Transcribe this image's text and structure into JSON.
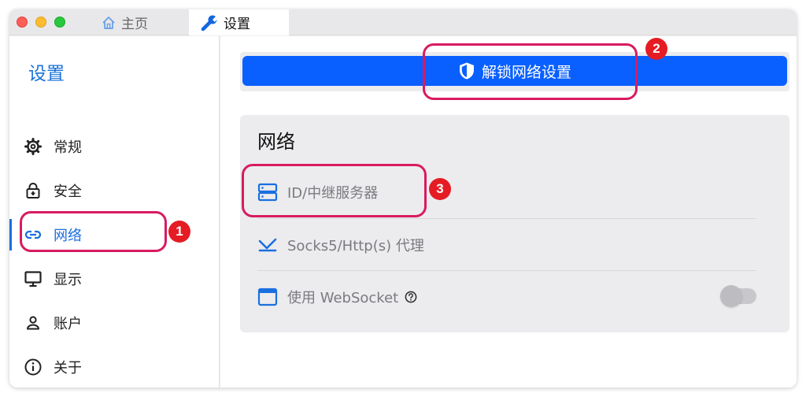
{
  "tabs": [
    {
      "label": "主页",
      "icon": "home-icon"
    },
    {
      "label": "设置",
      "icon": "wrench-icon"
    }
  ],
  "sidebar": {
    "title": "设置",
    "items": [
      {
        "label": "常规",
        "icon": "gear-icon"
      },
      {
        "label": "安全",
        "icon": "lock-icon"
      },
      {
        "label": "网络",
        "icon": "link-icon",
        "active": true
      },
      {
        "label": "显示",
        "icon": "monitor-icon"
      },
      {
        "label": "账户",
        "icon": "user-icon"
      },
      {
        "label": "关于",
        "icon": "info-icon"
      }
    ]
  },
  "unlock_button": {
    "label": "解锁网络设置",
    "icon": "shield-icon"
  },
  "network": {
    "title": "网络",
    "rows": [
      {
        "label": "ID/中继服务器",
        "icon": "server-icon"
      },
      {
        "label": "Socks5/Http(s) 代理",
        "icon": "proxy-icon"
      },
      {
        "label": "使用 WebSocket",
        "icon": "window-icon",
        "toggle_on": false
      }
    ]
  },
  "annotations": [
    "1",
    "2",
    "3"
  ],
  "colors": {
    "accent": "#0a60ff",
    "sidebar_active": "#1a6fe0",
    "highlight": "#d81b60",
    "badge": "#e51c23"
  }
}
